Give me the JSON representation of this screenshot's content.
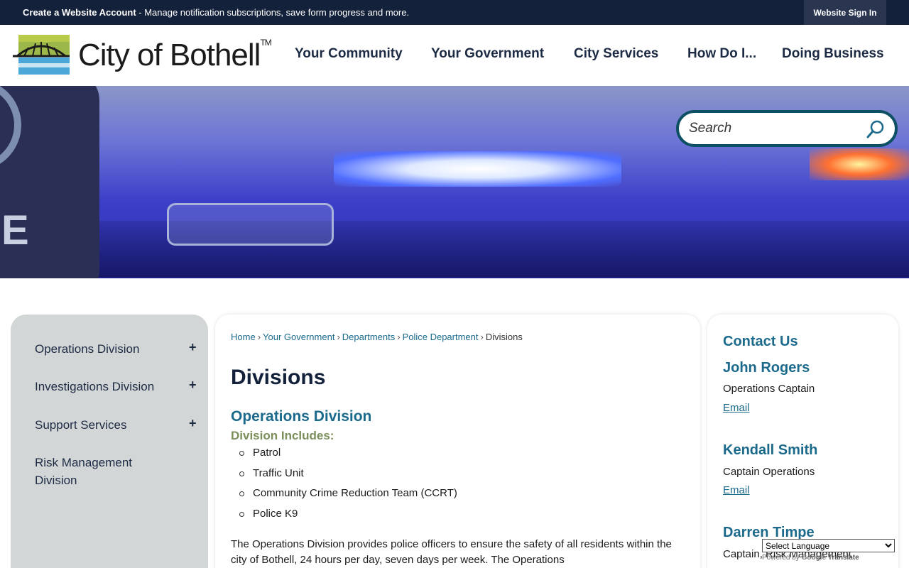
{
  "topbar": {
    "account_bold": "Create a Website Account",
    "account_rest": " - Manage notification subscriptions, save form progress and more.",
    "signin_label": "Website Sign In"
  },
  "header": {
    "logo_text": "City of Bothell",
    "logo_tm": "TM",
    "nav": [
      "Your Community",
      "Your Government",
      "City Services",
      "How Do I...",
      "Doing Business"
    ]
  },
  "hero": {
    "patch_text": "ICE",
    "search_placeholder": "Search"
  },
  "sidebar": {
    "items": [
      {
        "label": "Operations Division",
        "expand": "+"
      },
      {
        "label": "Investigations Division",
        "expand": "+"
      },
      {
        "label": "Support Services",
        "expand": "+"
      },
      {
        "label": "Risk Management Division"
      }
    ]
  },
  "breadcrumb": {
    "links": [
      "Home",
      "Your Government",
      "Departments",
      "Police Department"
    ],
    "separator": "›",
    "current": "Divisions"
  },
  "main": {
    "title": "Divisions",
    "section_title": "Operations Division",
    "includes_label": "Division Includes:",
    "bullets": [
      "Patrol",
      "Traffic Unit",
      "Community Crime Reduction Team (CCRT)",
      "Police K9"
    ],
    "body": "The Operations Division provides police officers to ensure the safety of all residents within the city of Bothell, 24 hours per day, seven days per week. The Operations"
  },
  "contact": {
    "title": "Contact Us",
    "people": [
      {
        "name": "John Rogers",
        "role": "Operations Captain",
        "email_label": "Email"
      },
      {
        "name": "Kendall Smith",
        "role": "Captain Operations",
        "email_label": "Email"
      },
      {
        "name": "Darren Timpe",
        "role": "Captain, Risk Management"
      }
    ]
  },
  "translate": {
    "select_label": "Select Language",
    "powered_by": "Powered by",
    "google": "Google",
    "translate_word": "Translate"
  },
  "colors": {
    "topbar": "#14213a",
    "accent_teal": "#1b6a8c",
    "olive": "#7b8f5a",
    "sidebar_bg": "#d3d6d6"
  }
}
